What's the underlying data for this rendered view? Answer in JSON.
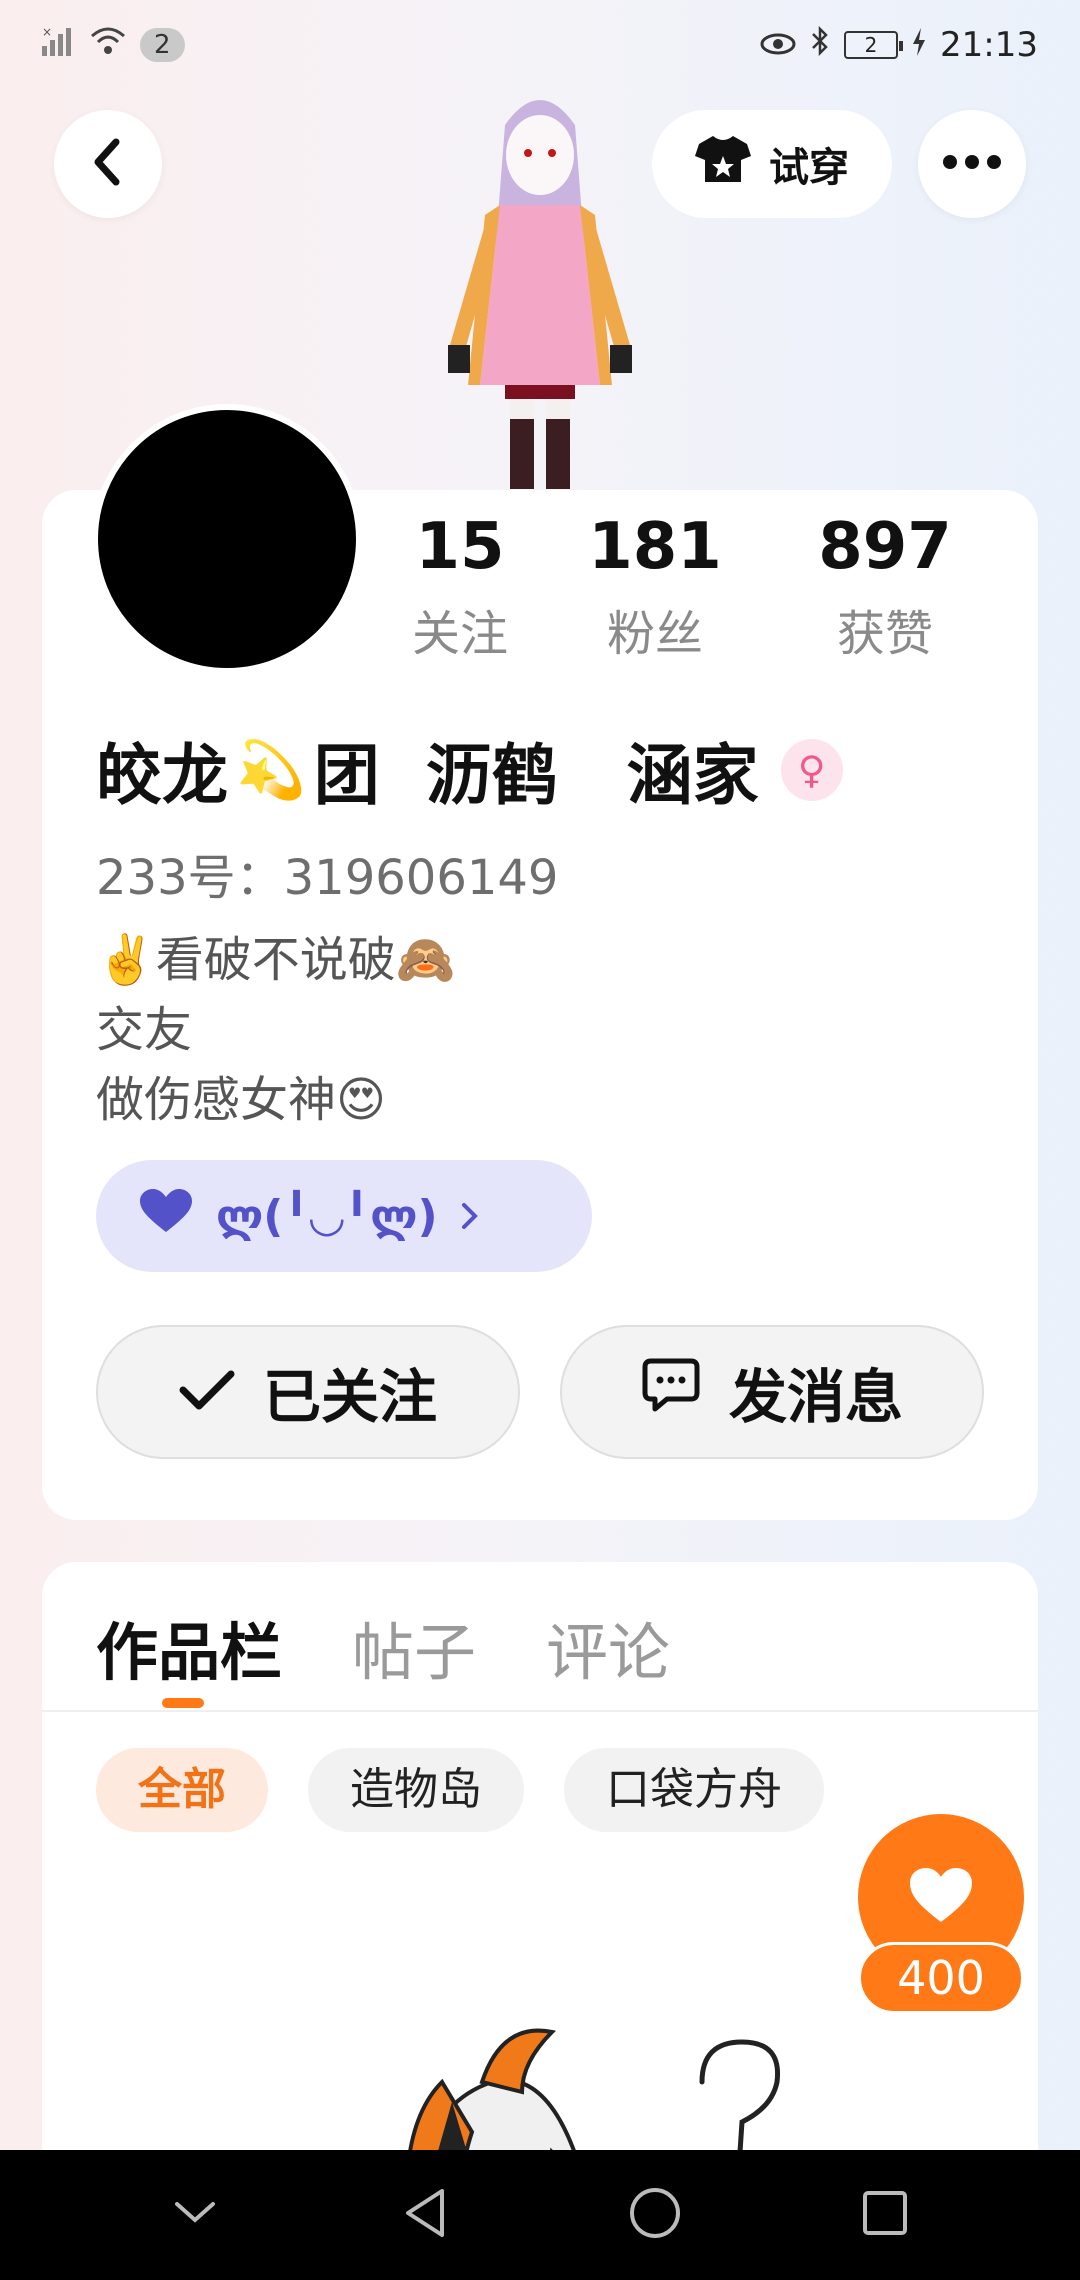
{
  "status_bar": {
    "notification_count": "2",
    "battery_level": "2",
    "time": "21:13",
    "icons": [
      "signal-icon",
      "wifi-icon",
      "eye-icon",
      "bluetooth-icon",
      "battery-icon",
      "charging-icon"
    ]
  },
  "header": {
    "try_on_label": "试穿",
    "icons": [
      "back-arrow-icon",
      "tshirt-icon",
      "more-dots-icon"
    ]
  },
  "profile": {
    "stats": [
      {
        "value": "15",
        "label": "关注"
      },
      {
        "value": "181",
        "label": "粉丝"
      },
      {
        "value": "897",
        "label": "获赞"
      }
    ],
    "name_part1": "皎龙",
    "name_emoji": "💫",
    "name_part2": "团  沥鹤   涵家",
    "gender_symbol": "♀",
    "uid": "233号：319606149",
    "bio": [
      "✌️看破不说破🙈",
      "交友",
      "做伤感女神😍"
    ],
    "tag_text": "ლ(╹◡╹ლ)",
    "follow_label": "已关注",
    "message_label": "发消息"
  },
  "tabs": [
    {
      "label": "作品栏",
      "active": true
    },
    {
      "label": "帖子",
      "active": false
    },
    {
      "label": "评论",
      "active": false
    }
  ],
  "filters": [
    {
      "label": "全部",
      "active": true
    },
    {
      "label": "造物岛",
      "active": false
    },
    {
      "label": "口袋方舟",
      "active": false
    }
  ],
  "like_count": "400",
  "colors": {
    "accent_orange": "#ff7a17",
    "tag_bg": "#e4e4fa",
    "tag_text": "#5452c8",
    "gender_pink": "#ef5a8a"
  }
}
